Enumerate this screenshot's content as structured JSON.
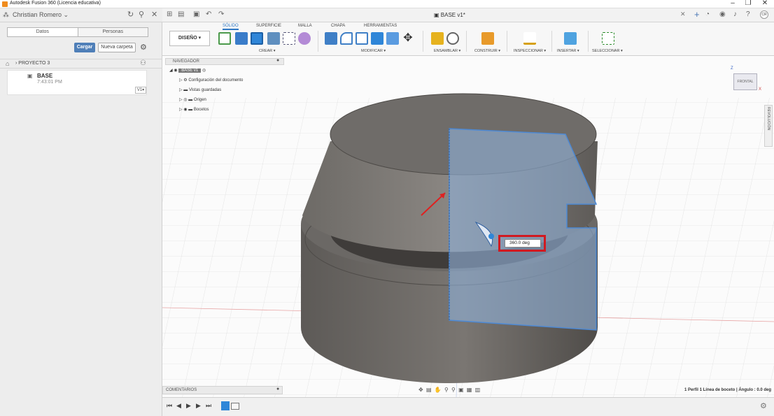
{
  "window": {
    "title": "Autodesk Fusion 360 (Licencia educativa)",
    "minimize": "–",
    "maximize": "❐",
    "close": "✕"
  },
  "data_panel": {
    "user_name": "Christian Romero ⌄",
    "tabs": [
      "Datos",
      "Personas"
    ],
    "upload_button": "Cargar",
    "new_folder_button": "Nueva carpeta",
    "breadcrumb": "PROYECTO 3",
    "file": {
      "name": "BASE",
      "time": "7:43:01 PM",
      "version": "V1▾"
    }
  },
  "doc_tab": {
    "title": "BASE v1*"
  },
  "avatar_initials": "CR",
  "ribbon": {
    "workspace": "DISEÑO ▾",
    "tabs": [
      "SÓLIDO",
      "SUPERFICIE",
      "MALLA",
      "CHAPA",
      "HERRAMIENTAS"
    ],
    "groups": [
      "CREAR ▾",
      "MODIFICAR ▾",
      "ENSAMBLAR ▾",
      "CONSTRUIR ▾",
      "INSPECCIONAR ▾",
      "INSERTAR ▾",
      "SELECCIONAR ▾"
    ]
  },
  "browser": {
    "header": "NAVEGADOR",
    "root": "BASE v1",
    "items": [
      "Configuración del documento",
      "Vistas guardadas",
      "Origen",
      "Bocetos"
    ]
  },
  "dimension": {
    "value": "360.0 deg"
  },
  "viewcube": {
    "face": "FRONTAL",
    "axis_z": "Z",
    "axis_x": "X"
  },
  "side_tab": "REVOLUCIÓN",
  "comments": {
    "label": "COMENTARIOS"
  },
  "status": "1 Perfil 1 Línea de boceto | Ángulo : 0.0 deg",
  "colors": {
    "accent": "#2f78c4",
    "highlight_box": "#d11920",
    "profile_fill": "#8fb0d6",
    "solid": "#6a6764"
  }
}
